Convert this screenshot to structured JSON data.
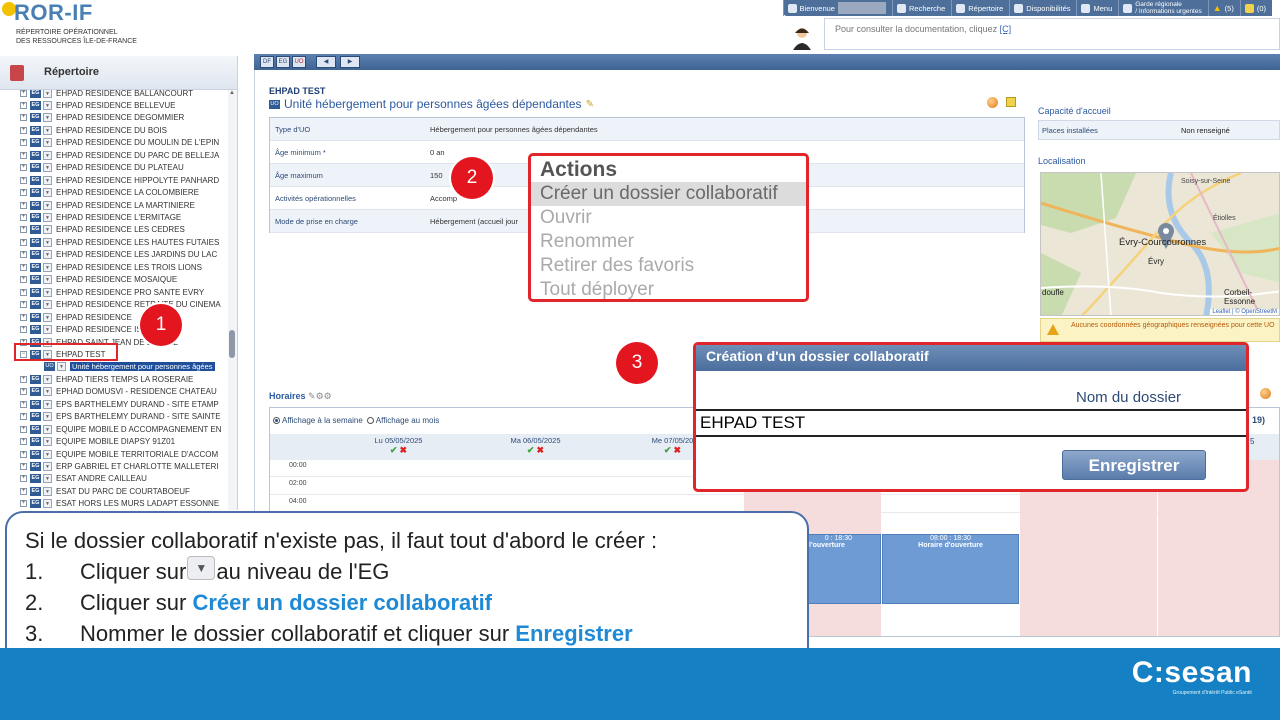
{
  "header": {
    "logo_title": "ROR-IF",
    "logo_sub_1": "RÉPERTOIRE OPÉRATIONNEL",
    "logo_sub_2": "DES RESSOURCES ÎLE-DE-FRANCE",
    "nav": {
      "bienvenue": "Bienvenue",
      "recherche": "Recherche",
      "repertoire": "Répertoire",
      "disponibilites": "Disponibilités",
      "menu": "Menu",
      "garde_1": "Garde régionale",
      "garde_2": "/ Informations urgentes",
      "alerts": "(5)",
      "notes": "(0)"
    },
    "doc_text": "Pour consulter la documentation, cliquez ",
    "doc_link": "[C]"
  },
  "left_panel": {
    "title": "Répertoire",
    "tree_items": [
      "EHPAD RESIDENCE BALLANCOURT",
      "EHPAD RESIDENCE BELLEVUE",
      "EHPAD RESIDENCE DEGOMMIER",
      "EHPAD RESIDENCE DU BOIS",
      "EHPAD RESIDENCE DU MOULIN DE L'EPIN",
      "EHPAD RESIDENCE DU PARC DE BELLEJA",
      "EHPAD RESIDENCE DU PLATEAU",
      "EHPAD RESIDENCE HIPPOLYTE PANHARD",
      "EHPAD RESIDENCE LA COLOMBIERE",
      "EHPAD RESIDENCE LA MARTINIERE",
      "EHPAD RESIDENCE L'ERMITAGE",
      "EHPAD RESIDENCE LES CEDRES",
      "EHPAD RESIDENCE LES HAUTES FUTAIES",
      "EHPAD RESIDENCE LES JARDINS DU LAC",
      "EHPAD RESIDENCE LES TROIS LIONS",
      "EHPAD RESIDENCE MOSAIQUE",
      "EHPAD RESIDENCE PRO SANTE EVRY",
      "EHPAD RESIDENCE RETRAITE DU CINEMA",
      "EHPAD RESIDENCE",
      "EHPAD RESIDENCE         IS",
      "EHPAD SAINT JEAN        DE LA SALL",
      "EHPAD TEST"
    ],
    "child_item": "Unité hébergement pour personnes âgées",
    "tree_items_after": [
      "EHPAD TIERS TEMPS LA ROSERAIE",
      "EPHAD DOMUSVI - RESIDENCE CHATEAU",
      "EPS BARTHELEMY DURAND - SITE ETAMP",
      "EPS BARTHELEMY DURAND - SITE SAINTE",
      "EQUIPE MOBILE D ACCOMPAGNEMENT EN",
      "EQUIPE MOBILE DIAPSY 91Z01",
      "EQUIPE MOBILE TERRITORIALE D'ACCOM",
      "ERP GABRIEL ET CHARLOTTE MALLETERI",
      "ESAT ANDRE CAILLEAU",
      "ESAT DU PARC DE COURTABOEUF",
      "ESAT HORS LES MURS LADAPT ESSONNE"
    ],
    "eg_badge": "EG",
    "uo_badge": "UO"
  },
  "toolbar": {
    "btn_df": "DF",
    "btn_eg": "EG",
    "btn_uo": "UO"
  },
  "main": {
    "ehpad_title": "EHPAD TEST",
    "uo_title": "Unité hébergement pour personnes âgées dépendantes",
    "details": [
      {
        "key": "Type d'UO",
        "value": "Hébergement pour personnes âgées dépendantes"
      },
      {
        "key": "Âge minimum *",
        "value": "0 an"
      },
      {
        "key": "Âge maximum",
        "value": "150"
      },
      {
        "key": "Activités opérationnelles",
        "value": "Accomp"
      },
      {
        "key": "Mode de prise en charge",
        "value": "Hébergement (accueil jour"
      }
    ],
    "capacite_title": "Capacité d'accueil",
    "places_label": "Places installées",
    "places_value": "Non renseigné",
    "localisation_title": "Localisation",
    "map_labels": {
      "soisy": "Soisy-sur-Seine",
      "etiolles": "Étiolles",
      "evry_courcouronnes": "Évry-Courcouronnes",
      "evry": "Évry",
      "corbeil": "Corbeil-Essonne",
      "doufle": "doufle",
      "attribution": "Leaflet | © OpenStreetM"
    },
    "map_warning": "Aucunes coordonnées géographiques renseignées pour cette UO",
    "horaires_title": "Horaires",
    "radio_week": "Affichage à la semaine",
    "radio_month": "Affichage au mois",
    "days": [
      "Lu 05/05/2025",
      "Ma 06/05/2025",
      "Me 07/05/20"
    ],
    "times": [
      "00:00",
      "02:00",
      "04:00"
    ],
    "slot_time": "08:00 : 18:30",
    "slot_label": "Horaire d'ouverture",
    "slot_label_cut": "l'ouverture",
    "slot_time_cut": "0 : 18:30",
    "week_suffix": "19)",
    "day_suffix": "5"
  },
  "actions_menu": {
    "title": "Actions",
    "items": [
      "Créer un dossier collaboratif",
      "Ouvrir",
      "Renommer",
      "Retirer des favoris",
      "Tout déployer"
    ]
  },
  "create_dialog": {
    "title": "Création d'un dossier collaboratif",
    "label": "Nom du dossier",
    "value": "EHPAD TEST",
    "save": "Enregistrer"
  },
  "steps": [
    "1",
    "2",
    "3"
  ],
  "instructions": {
    "intro": "Si le dossier collaboratif n'existe pas, il faut tout d'abord le créer :",
    "s1_num": "1.",
    "s1_a": "Cliquer sur",
    "s1_b": "au niveau de l'EG",
    "s2_num": "2.",
    "s2_a": "Cliquer sur ",
    "s2_hl": "Créer un dossier collaboratif",
    "s3_num": "3.",
    "s3_a": "Nommer le dossier collaboratif et cliquer sur ",
    "s3_hl": "Enregistrer"
  },
  "footer": {
    "brand": "sesan",
    "brand_sub": "Groupement d'Intérêt Public eSanté"
  },
  "colors": {
    "accent_red": "#e3151f",
    "header_blue": "#4d6f9a",
    "footer_blue": "#1581c4",
    "highlight_text": "#1e8ad6"
  }
}
